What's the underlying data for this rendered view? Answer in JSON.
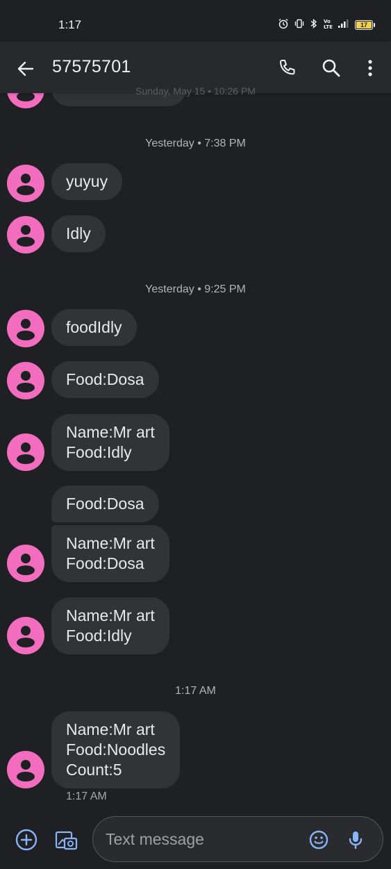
{
  "status_bar": {
    "time": "1:17",
    "battery_level": "17",
    "icons": [
      "alarm-icon",
      "vibrate-icon",
      "bluetooth-icon",
      "volte-icon",
      "signal-icon",
      "battery-icon"
    ]
  },
  "app_bar": {
    "title": "57575701",
    "faded_header": "Sunday, May 15 • 10:26 PM",
    "actions": [
      "back-arrow-icon",
      "phone-icon",
      "search-icon",
      "more-vert-icon"
    ]
  },
  "conversation": {
    "partial_message": "Hello from avic",
    "timestamps": [
      "Yesterday • 7:38 PM",
      "Yesterday • 9:25 PM",
      "1:17 AM"
    ],
    "messages": [
      "yuyuy",
      "Idly",
      "foodIdly",
      "Food:Dosa",
      "Name:Mr art\nFood:Idly",
      "Food:Dosa",
      "Name:Mr art\nFood:Dosa",
      "Name:Mr art\nFood:Idly",
      "Name:Mr art\nFood:Noodles\nCount:5"
    ],
    "last_message_time": "1:17 AM"
  },
  "compose": {
    "placeholder": "Text message",
    "icons": [
      "add-circle-icon",
      "gallery-icon",
      "emoji-icon",
      "mic-icon"
    ]
  },
  "colors": {
    "background": "#1f2023",
    "bubble": "#323337",
    "avatar": "#f36dbe",
    "accent": "#8ab4f8"
  }
}
